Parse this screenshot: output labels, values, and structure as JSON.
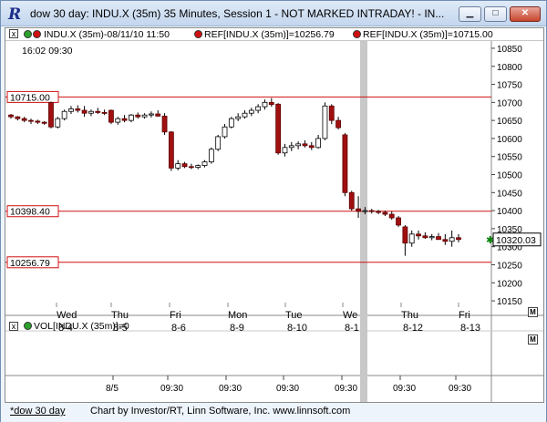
{
  "window": {
    "title": "dow 30 day: INDU.X (35m) 35 Minutes, Session 1 - NOT MARKED INTRADAY! - IN...",
    "minimize_label": "▁",
    "maximize_label": "□",
    "close_label": "✕"
  },
  "header": {
    "close_box": "x",
    "series_label": "INDU.X (35m)-08/11/10 11:50",
    "ref1_label": "REF[INDU.X (35m)]=10256.79",
    "ref2_label": "REF[INDU.X (35m)]=10715.00",
    "timestamp": "16:02  09:30"
  },
  "volume_pane": {
    "label": "VOL[INDU.X (35m)]=0",
    "close_box": "x",
    "m_label": "M"
  },
  "price_pane": {
    "m_label": "M"
  },
  "chart_data": {
    "type": "candlestick",
    "y_axis_ticks": [
      10850,
      10800,
      10750,
      10700,
      10650,
      10600,
      10550,
      10500,
      10450,
      10400,
      10350,
      10300,
      10250,
      10200,
      10150
    ],
    "ylim": [
      10135,
      10860
    ],
    "current_price_label": "10320.03",
    "current_price_color": "#008000",
    "reference_lines": [
      {
        "label": "10715.00",
        "value": 10715.0,
        "color": "#d01010"
      },
      {
        "label": "10398.40",
        "value": 10398.4,
        "color": "#d01010"
      },
      {
        "label": "10256.79",
        "value": 10256.79,
        "color": "#d01010"
      }
    ],
    "day_labels": [
      {
        "weekday": "Wed",
        "date": "8-4"
      },
      {
        "weekday": "Thu",
        "date": "8-5"
      },
      {
        "weekday": "Fri",
        "date": "8-6"
      },
      {
        "weekday": "Mon",
        "date": "8-9"
      },
      {
        "weekday": "Tue",
        "date": "8-10"
      },
      {
        "weekday": "We",
        "date": "8-1"
      },
      {
        "weekday": "Thu",
        "date": "8-12"
      },
      {
        "weekday": "Fri",
        "date": "8-13"
      }
    ],
    "bottom_axis_labels": [
      "8/5",
      "09:30",
      "09:30",
      "09:30",
      "09:30",
      "09:30",
      "09:30"
    ],
    "candles": [
      [
        10665,
        10668,
        10655,
        10660
      ],
      [
        10660,
        10662,
        10650,
        10655
      ],
      [
        10655,
        10660,
        10645,
        10650
      ],
      [
        10650,
        10655,
        10640,
        10648
      ],
      [
        10648,
        10652,
        10640,
        10645
      ],
      [
        10645,
        10648,
        10638,
        10642
      ],
      [
        10700,
        10702,
        10628,
        10632
      ],
      [
        10632,
        10660,
        10628,
        10655
      ],
      [
        10655,
        10680,
        10650,
        10675
      ],
      [
        10675,
        10690,
        10668,
        10682
      ],
      [
        10682,
        10692,
        10672,
        10678
      ],
      [
        10678,
        10690,
        10660,
        10670
      ],
      [
        10670,
        10680,
        10662,
        10675
      ],
      [
        10675,
        10685,
        10668,
        10672
      ],
      [
        10672,
        10680,
        10665,
        10670
      ],
      [
        10678,
        10680,
        10640,
        10645
      ],
      [
        10645,
        10660,
        10638,
        10655
      ],
      [
        10655,
        10665,
        10645,
        10650
      ],
      [
        10650,
        10668,
        10645,
        10665
      ],
      [
        10665,
        10672,
        10655,
        10660
      ],
      [
        10660,
        10670,
        10655,
        10665
      ],
      [
        10665,
        10675,
        10658,
        10668
      ],
      [
        10668,
        10678,
        10660,
        10662
      ],
      [
        10662,
        10670,
        10610,
        10618
      ],
      [
        10618,
        10620,
        10510,
        10518
      ],
      [
        10518,
        10540,
        10512,
        10530
      ],
      [
        10530,
        10535,
        10518,
        10522
      ],
      [
        10522,
        10530,
        10515,
        10520
      ],
      [
        10520,
        10528,
        10515,
        10525
      ],
      [
        10525,
        10540,
        10520,
        10535
      ],
      [
        10535,
        10575,
        10530,
        10570
      ],
      [
        10570,
        10610,
        10565,
        10605
      ],
      [
        10605,
        10640,
        10600,
        10632
      ],
      [
        10632,
        10660,
        10628,
        10655
      ],
      [
        10655,
        10670,
        10648,
        10660
      ],
      [
        10660,
        10678,
        10655,
        10670
      ],
      [
        10670,
        10685,
        10662,
        10678
      ],
      [
        10678,
        10695,
        10670,
        10688
      ],
      [
        10688,
        10708,
        10680,
        10700
      ],
      [
        10700,
        10712,
        10688,
        10694
      ],
      [
        10695,
        10698,
        10555,
        10560
      ],
      [
        10560,
        10585,
        10550,
        10575
      ],
      [
        10575,
        10590,
        10565,
        10580
      ],
      [
        10580,
        10592,
        10570,
        10585
      ],
      [
        10585,
        10595,
        10575,
        10580
      ],
      [
        10580,
        10590,
        10568,
        10575
      ],
      [
        10575,
        10610,
        10572,
        10600
      ],
      [
        10600,
        10700,
        10595,
        10690
      ],
      [
        10690,
        10695,
        10640,
        10650
      ],
      [
        10650,
        10660,
        10625,
        10630
      ],
      [
        10610,
        10615,
        10440,
        10450
      ],
      [
        10450,
        10455,
        10400,
        10405
      ],
      [
        10405,
        10440,
        10380,
        10398
      ],
      [
        10398,
        10410,
        10390,
        10400
      ],
      [
        10400,
        10405,
        10392,
        10398
      ],
      [
        10398,
        10402,
        10390,
        10395
      ],
      [
        10395,
        10400,
        10385,
        10390
      ],
      [
        10390,
        10398,
        10375,
        10380
      ],
      [
        10380,
        10385,
        10355,
        10360
      ],
      [
        10355,
        10360,
        10275,
        10310
      ],
      [
        10310,
        10345,
        10300,
        10335
      ],
      [
        10335,
        10345,
        10320,
        10330
      ],
      [
        10330,
        10340,
        10322,
        10325
      ],
      [
        10325,
        10335,
        10318,
        10328
      ],
      [
        10328,
        10338,
        10320,
        10320
      ],
      [
        10320,
        10335,
        10305,
        10315
      ],
      [
        10315,
        10345,
        10300,
        10325
      ],
      [
        10325,
        10335,
        10312,
        10320
      ]
    ]
  },
  "status": {
    "link_label": "*dow 30 day",
    "credit": "Chart by Investor/RT, Linn Software, Inc. www.linnsoft.com"
  }
}
